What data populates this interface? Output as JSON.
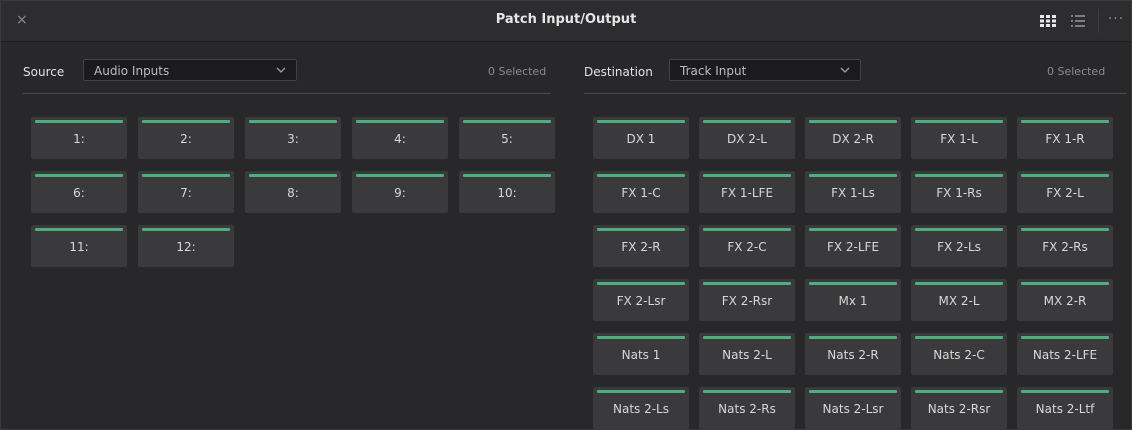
{
  "window": {
    "title": "Patch Input/Output",
    "close_icon": "×",
    "more_icon": "···"
  },
  "source": {
    "label": "Source",
    "dropdown_value": "Audio Inputs",
    "selected_text": "0 Selected",
    "tiles": [
      "1:",
      "2:",
      "3:",
      "4:",
      "5:",
      "6:",
      "7:",
      "8:",
      "9:",
      "10:",
      "11:",
      "12:"
    ]
  },
  "destination": {
    "label": "Destination",
    "dropdown_value": "Track Input",
    "selected_text": "0 Selected",
    "tiles": [
      "DX 1",
      "DX 2-L",
      "DX 2-R",
      "FX 1-L",
      "FX 1-R",
      "FX 1-C",
      "FX 1-LFE",
      "FX 1-Ls",
      "FX 1-Rs",
      "FX 2-L",
      "FX 2-R",
      "FX 2-C",
      "FX 2-LFE",
      "FX 2-Ls",
      "FX 2-Rs",
      "FX 2-Lsr",
      "FX 2-Rsr",
      "Mx 1",
      "MX 2-L",
      "MX 2-R",
      "Nats 1",
      "Nats 2-L",
      "Nats 2-R",
      "Nats 2-C",
      "Nats 2-LFE",
      "Nats 2-Ls",
      "Nats 2-Rs",
      "Nats 2-Lsr",
      "Nats 2-Rsr",
      "Nats 2-Ltf"
    ]
  },
  "colors": {
    "tile_indicator": "#4dad7d",
    "background": "#28282a",
    "tile": "#3a3a3c"
  }
}
